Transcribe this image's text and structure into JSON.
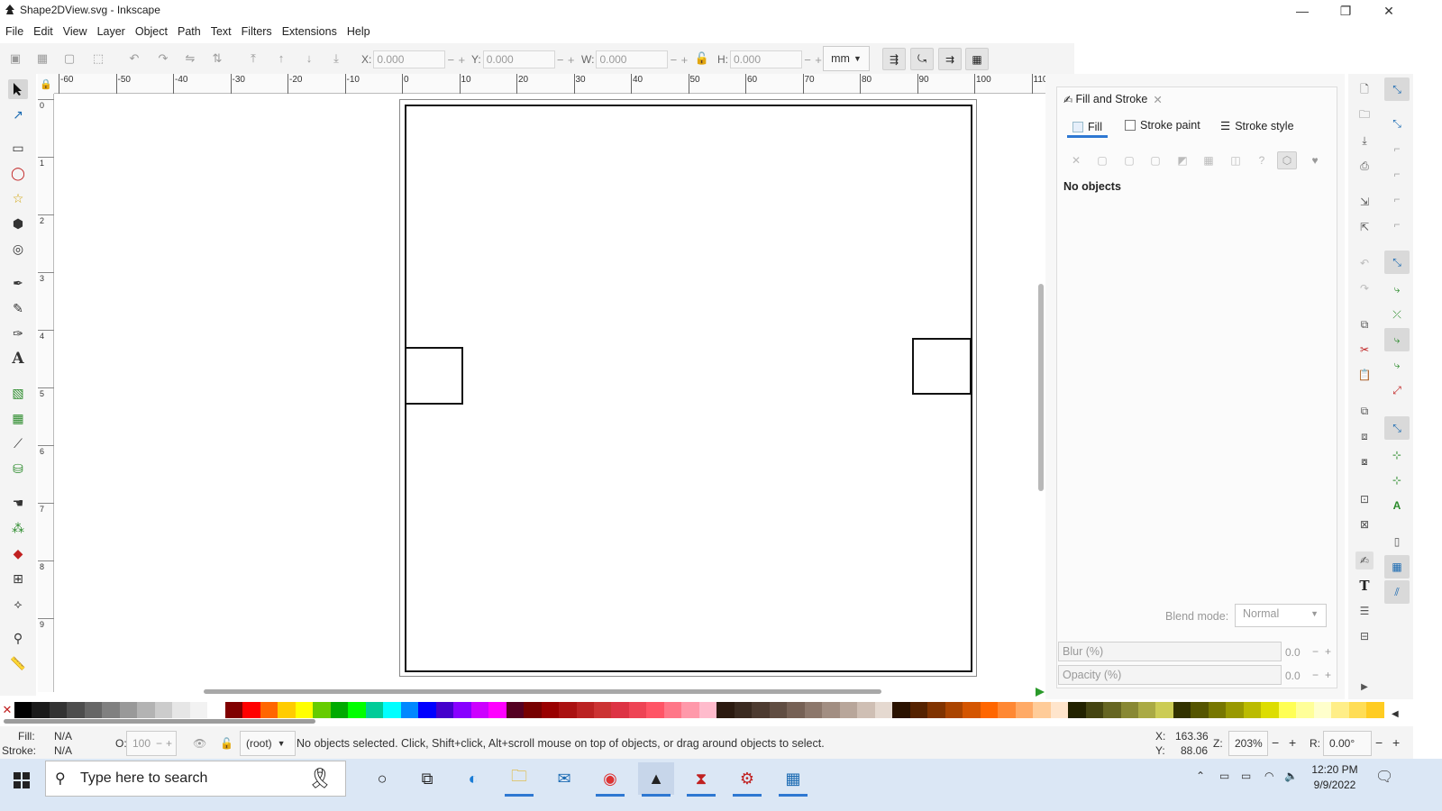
{
  "window": {
    "title": "Shape2DView.svg - Inkscape",
    "minimize": "—",
    "restore": "❐",
    "close": "✕"
  },
  "menu": [
    "File",
    "Edit",
    "View",
    "Layer",
    "Object",
    "Path",
    "Text",
    "Filters",
    "Extensions",
    "Help"
  ],
  "controls": {
    "x_label": "X:",
    "x_value": "0.000",
    "y_label": "Y:",
    "y_value": "0.000",
    "w_label": "W:",
    "w_value": "0.000",
    "h_label": "H:",
    "h_value": "0.000",
    "unit": "mm",
    "minus": "−",
    "plus": "+"
  },
  "ruler": {
    "h_labels": [
      "-60",
      "-50",
      "-40",
      "-30",
      "-20",
      "-10",
      "0",
      "10",
      "20",
      "30",
      "40",
      "50",
      "60",
      "70",
      "80",
      "90",
      "100",
      "110"
    ],
    "v_labels": [
      "0",
      "1",
      "2",
      "3",
      "4",
      "5",
      "6",
      "7",
      "8",
      "9"
    ]
  },
  "tools": [
    "selector-icon",
    "node-icon",
    "rect-icon",
    "ellipse-icon",
    "star-icon",
    "3dbox-icon",
    "spiral-icon",
    "pen-icon",
    "pencil-icon",
    "calligraphy-icon",
    "text-icon",
    "gradient-icon",
    "mesh-icon",
    "dropper-icon",
    "paint-bucket-icon",
    "tweak-icon",
    "spray-icon",
    "eraser-icon",
    "connector-icon",
    "lpe-icon",
    "zoom-icon",
    "measure-icon"
  ],
  "fill_stroke": {
    "panel_title": "Fill and Stroke",
    "tab_fill": "Fill",
    "tab_stroke_paint": "Stroke paint",
    "tab_stroke_style": "Stroke style",
    "no_objects": "No objects",
    "blend_label": "Blend mode:",
    "blend_value": "Normal",
    "blur_label": "Blur (%)",
    "blur_value": "0.0",
    "opacity_label": "Opacity (%)",
    "opacity_value": "0.0",
    "unknown_paint": "?"
  },
  "status": {
    "fill_label": "Fill:",
    "fill_value": "N/A",
    "stroke_label": "Stroke:",
    "stroke_value": "N/A",
    "opacity_label": "O:",
    "opacity_value": "100",
    "layer": "(root)",
    "message": "No objects selected. Click, Shift+click, Alt+scroll mouse on top of objects, or drag around objects to select.",
    "x_label": "X:",
    "x_value": "163.36",
    "y_label": "Y:",
    "y_value": "88.06",
    "zoom_label": "Z:",
    "zoom_value": "203%",
    "rot_label": "R:",
    "rot_value": "0.00°"
  },
  "palette_colors": [
    "#000000",
    "#1a1a1a",
    "#333333",
    "#4d4d4d",
    "#666666",
    "#808080",
    "#999999",
    "#b3b3b3",
    "#cccccc",
    "#e6e6e6",
    "#f2f2f2",
    "#ffffff",
    "#800000",
    "#ff0000",
    "#ff6600",
    "#ffcc00",
    "#ffff00",
    "#66cc00",
    "#00aa00",
    "#00ff00",
    "#00cc99",
    "#00ffff",
    "#0088ff",
    "#0000ff",
    "#4400cc",
    "#8800ff",
    "#cc00ff",
    "#ff00ff",
    "#550022",
    "#770000",
    "#990000",
    "#aa1111",
    "#bb2222",
    "#cc3333",
    "#dd3344",
    "#ee4455",
    "#ff5566",
    "#ff7788",
    "#ff99aa",
    "#ffbbcc",
    "#2b1a10",
    "#3a2a20",
    "#4d3b30",
    "#604d42",
    "#766155",
    "#8c776b",
    "#a28e82",
    "#b8a69a",
    "#cfbfb4",
    "#e5d9d0",
    "#2a1200",
    "#552200",
    "#803300",
    "#aa4400",
    "#d45500",
    "#ff6600",
    "#ff8833",
    "#ffaa66",
    "#ffcc99",
    "#ffe5cc",
    "#222200",
    "#444411",
    "#666622",
    "#888833",
    "#aaaa44",
    "#cccc55",
    "#333300",
    "#555500",
    "#777700",
    "#999900",
    "#bbbb00",
    "#dddd00",
    "#ffff55",
    "#ffff99",
    "#ffffcc",
    "#ffee88",
    "#ffdd55",
    "#ffcc22"
  ],
  "taskbar": {
    "search_placeholder": "Type here to search",
    "time": "12:20 PM",
    "date": "9/9/2022"
  }
}
